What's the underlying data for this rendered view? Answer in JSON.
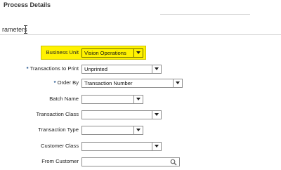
{
  "header": {
    "title": "Process Details",
    "parameters_label": "rameters"
  },
  "form": {
    "business_unit": {
      "label": "Business Unit",
      "value": "Vision Operations"
    },
    "transactions_to_print": {
      "label": "Transactions to Print",
      "value": "Unprinted",
      "required": "*"
    },
    "order_by": {
      "label": "Order By",
      "value": "Transaction Number",
      "required": "*"
    },
    "batch_name": {
      "label": "Batch Name",
      "value": ""
    },
    "transaction_class": {
      "label": "Transaction Class",
      "value": ""
    },
    "transaction_type": {
      "label": "Transaction Type",
      "value": ""
    },
    "customer_class": {
      "label": "Customer Class",
      "value": ""
    },
    "from_customer": {
      "label": "From Customer",
      "value": ""
    }
  },
  "icons": {
    "dropdown": "chevron-down-icon",
    "search": "search-icon"
  },
  "colors": {
    "highlight": "#fff200",
    "required_marker": "#1b4f8a"
  }
}
